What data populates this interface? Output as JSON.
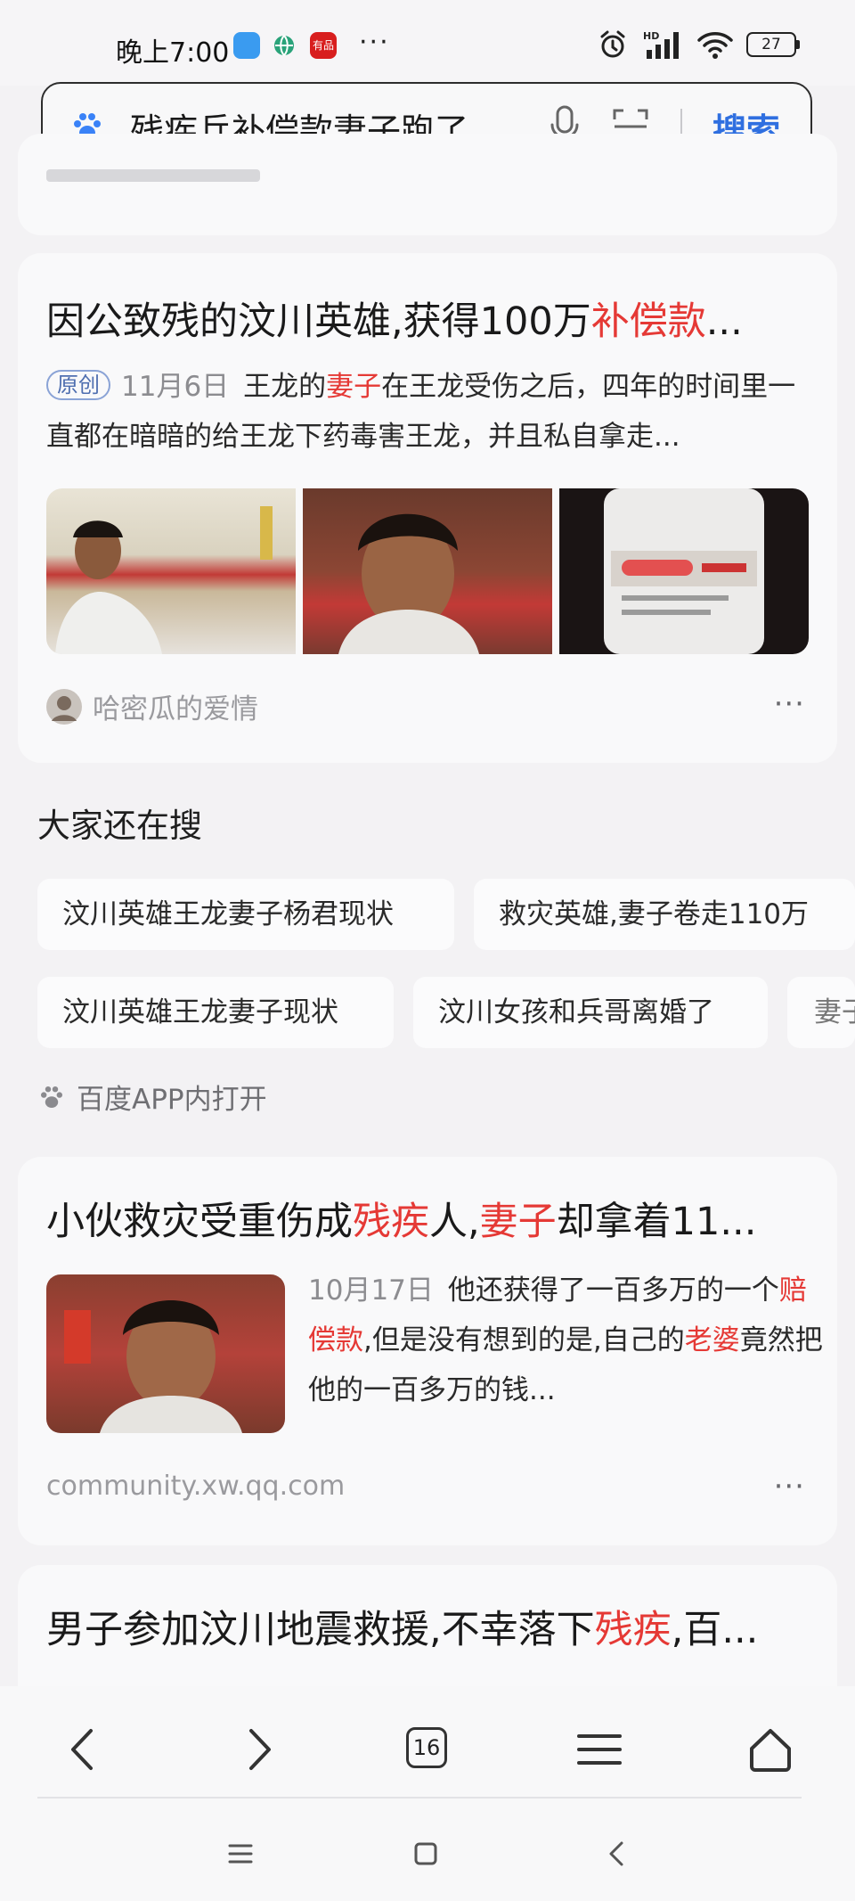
{
  "status_bar": {
    "time": "晚上7:00",
    "app_badge": "有品",
    "overflow": "···",
    "network": "HD",
    "battery": "27"
  },
  "search": {
    "query": "残疾兵补偿款妻子跑了",
    "button": "搜索"
  },
  "result1": {
    "title_plain": "因公致残的汶川英雄,获得100万",
    "title_red": "补偿款",
    "title_tail": "...",
    "tag": "原创",
    "date": "11月6日",
    "snippet_a": "王龙的",
    "snippet_red": "妻子",
    "snippet_b": "在王龙受伤之后，四年的时间里一直都在暗暗的给王龙下药毒害王龙，并且私自拿走...",
    "author": "哈密瓜的爱情",
    "more": "···"
  },
  "related": {
    "title": "大家还在搜",
    "chips": [
      "汶川英雄王龙妻子杨君现状",
      "救灾英雄,妻子卷走110万",
      "汶川英雄王龙妻子现状",
      "汶川女孩和兵哥离婚了",
      "妻子"
    ],
    "open_app": "百度APP内打开"
  },
  "result2": {
    "title_a": "小伙救灾受重伤成",
    "title_red1": "残疾",
    "title_b": "人,",
    "title_red2": "妻子",
    "title_c": "却拿着11...",
    "date": "10月17日",
    "snippet_a": "他还获得了一百多万的一个",
    "snippet_red1": "赔偿款",
    "snippet_b": ",但是没有想到的是,自己的",
    "snippet_red2": "老婆",
    "snippet_c": "竟然把他的一百多万的钱...",
    "source": "community.xw.qq.com",
    "more": "···"
  },
  "result3": {
    "title_a": "男子参加汶川地震救援,不幸落下",
    "title_red": "残疾",
    "title_b": ",百..."
  },
  "nav": {
    "tab_count": "16"
  },
  "colors": {
    "accent_blue": "#2f6fe0",
    "highlight_red": "#e53935",
    "background": "#f3f2f4"
  }
}
